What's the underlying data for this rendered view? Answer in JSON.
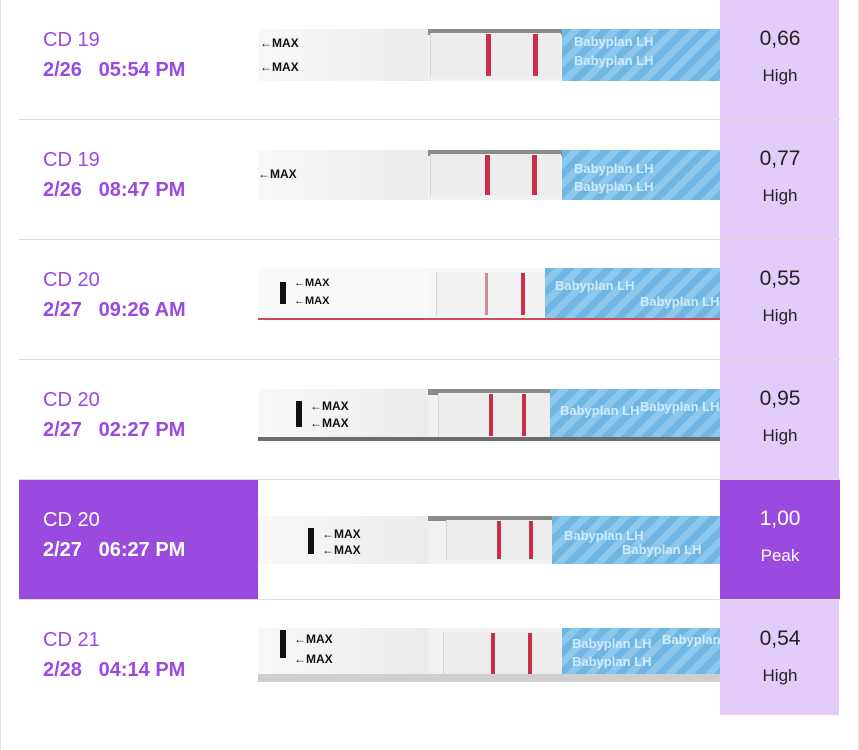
{
  "colors": {
    "accent": "#9b4ae0",
    "result_column": "#e3ccfa",
    "test_line": "#c8304a"
  },
  "strip": {
    "max_label": "←MAX",
    "brand": "Babyplan LH"
  },
  "tests": [
    {
      "cd": "CD 19",
      "date": "2/26",
      "time": "05:54 PM",
      "value": "0,66",
      "level": "High",
      "selected": false
    },
    {
      "cd": "CD 19",
      "date": "2/26",
      "time": "08:47 PM",
      "value": "0,77",
      "level": "High",
      "selected": false
    },
    {
      "cd": "CD 20",
      "date": "2/27",
      "time": "09:26 AM",
      "value": "0,55",
      "level": "High",
      "selected": false
    },
    {
      "cd": "CD 20",
      "date": "2/27",
      "time": "02:27 PM",
      "value": "0,95",
      "level": "High",
      "selected": false
    },
    {
      "cd": "CD 20",
      "date": "2/27",
      "time": "06:27 PM",
      "value": "1,00",
      "level": "Peak",
      "selected": true
    },
    {
      "cd": "CD 21",
      "date": "2/28",
      "time": "04:14 PM",
      "value": "0,54",
      "level": "High",
      "selected": false
    }
  ]
}
